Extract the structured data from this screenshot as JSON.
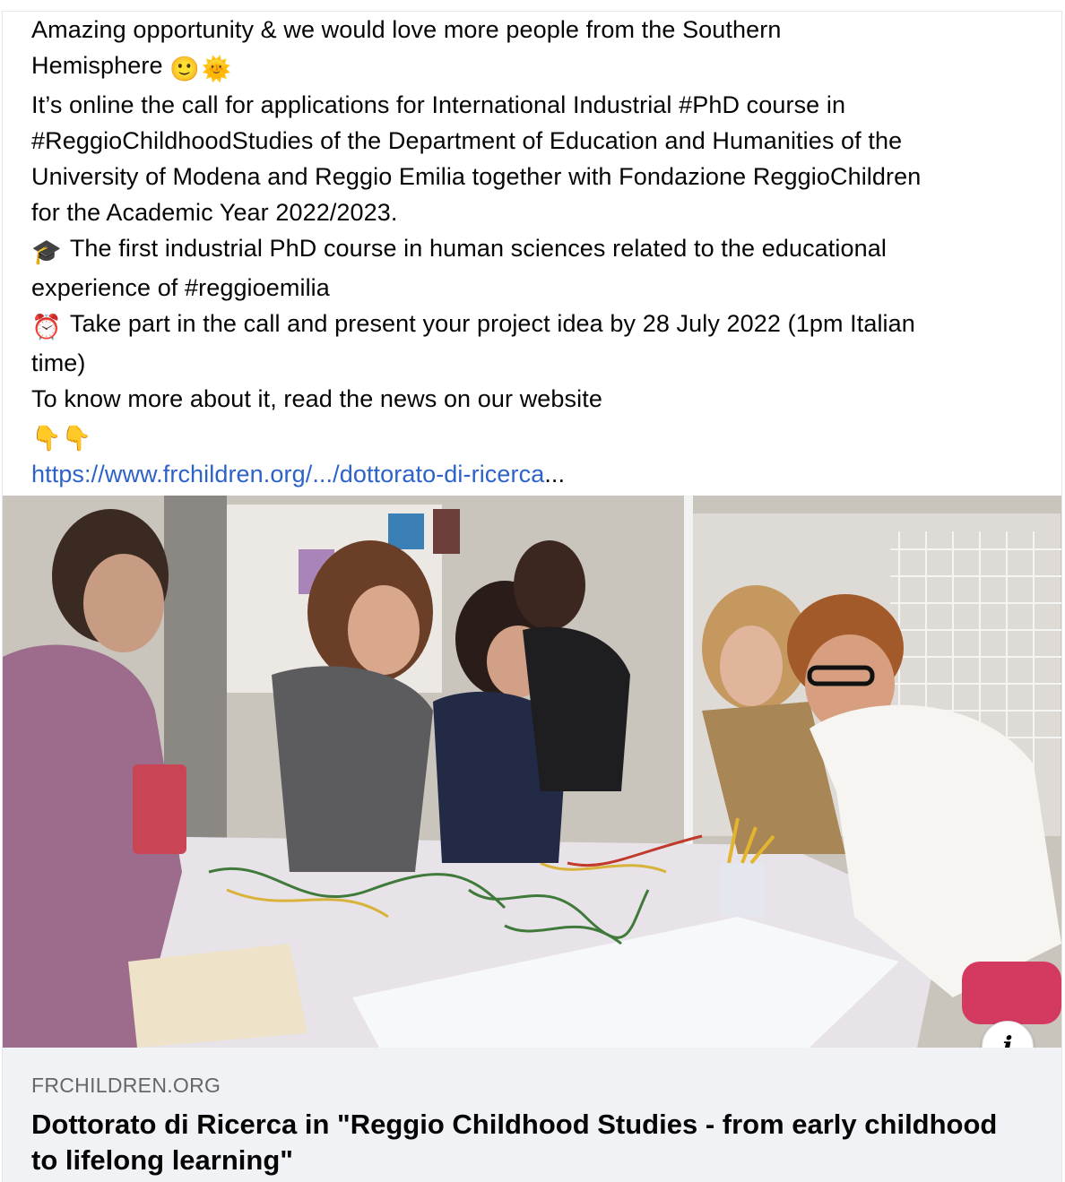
{
  "post": {
    "lines": [
      "Amazing opportunity & we would love more people from the Southern",
      "Hemisphere",
      "It’s online the call for applications for International Industrial #PhD course in",
      "#ReggioChildhoodStudies of the Department of Education and Humanities of the",
      "University of Modena and Reggio Emilia together with Fondazione ReggioChildren",
      "for the Academic Year 2022/2023.",
      "The first industrial PhD course in human sciences related to the educational",
      "experience of #reggioemilia",
      "Take part in the call and present your project idea by 28 July 2022 (1pm Italian",
      "time)",
      "To know more about it, read the news on our website"
    ],
    "emoji_smile": "🙂",
    "emoji_sun": "🌞",
    "emoji_grad_cap": "🎓",
    "emoji_alarm": "⏰",
    "emoji_point_down": "👇👇",
    "link_text": "https://www.frchildren.org/.../dottorato-di-ricerca",
    "link_ellipsis": "..."
  },
  "photo": {
    "alt_icon": "photo-of-women-around-light-table"
  },
  "info_button": {
    "label": "i",
    "icon": "info-icon"
  },
  "link_card": {
    "domain": "FRCHILDREN.ORG",
    "title": "Dottorato di Ricerca in \"Reggio Childhood Studies - from early childhood to lifelong learning\""
  },
  "colors": {
    "link": "#2d62c9",
    "card_bg": "#f0f2f5",
    "secondary_text": "#65676b"
  }
}
